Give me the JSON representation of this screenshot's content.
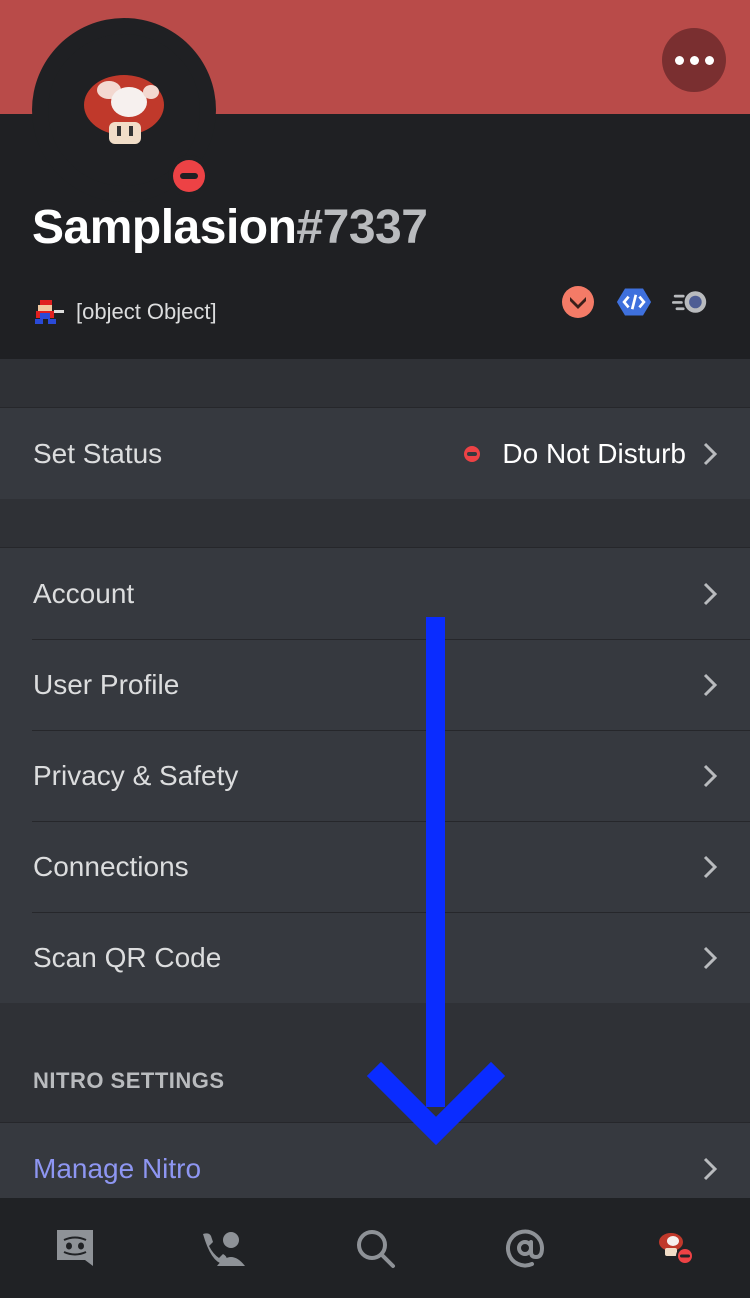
{
  "profile": {
    "username": "Samplasion",
    "discriminator": "#7337",
    "custom_status": "[object Object]",
    "status": "Do Not Disturb",
    "badges": [
      "hypesquad-brilliance-badge",
      "verified-developer-badge",
      "nitro-boost-badge"
    ]
  },
  "settings": {
    "set_status_label": "Set Status",
    "set_status_value": "Do Not Disturb",
    "account": "Account",
    "user_profile": "User Profile",
    "privacy_safety": "Privacy & Safety",
    "connections": "Connections",
    "scan_qr": "Scan QR Code",
    "nitro_section": "NITRO SETTINGS",
    "manage_nitro": "Manage Nitro"
  },
  "tabs": [
    "home-icon",
    "friends-icon",
    "search-icon",
    "mentions-icon",
    "profile-avatar-icon"
  ],
  "colors": {
    "banner": "#b94b49",
    "dnd": "#ed4245",
    "nitro": "#8e96f2",
    "arrow": "#0a2cff",
    "background": "#36393f"
  }
}
